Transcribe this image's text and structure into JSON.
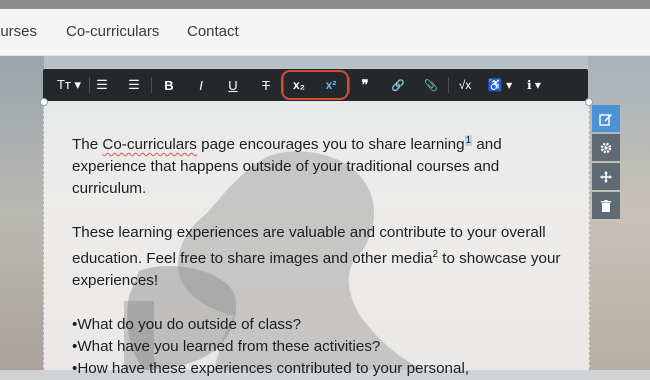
{
  "nav": {
    "items": [
      {
        "label": "ourses"
      },
      {
        "label": "Co-curriculars"
      },
      {
        "label": "Contact"
      }
    ]
  },
  "toolbar": {
    "buttons": [
      {
        "name": "text-style",
        "label": "Tт ▾"
      },
      {
        "name": "bullet-list",
        "label": "☰"
      },
      {
        "name": "numbered-list",
        "label": "☰"
      },
      {
        "name": "bold",
        "label": "B"
      },
      {
        "name": "italic",
        "label": "I"
      },
      {
        "name": "underline",
        "label": "U"
      },
      {
        "name": "strikethrough",
        "label": "T"
      },
      {
        "name": "subscript",
        "label": "x₂"
      },
      {
        "name": "superscript",
        "label": "x²"
      },
      {
        "name": "quote",
        "label": "❞"
      },
      {
        "name": "link",
        "label": "🔗"
      },
      {
        "name": "attach",
        "label": "📎"
      },
      {
        "name": "math",
        "label": "√x"
      },
      {
        "name": "accessibility",
        "label": "♿ ▾"
      },
      {
        "name": "info",
        "label": "ℹ ▾"
      }
    ]
  },
  "side_tools": [
    "edit-icon",
    "gear-icon",
    "move-icon",
    "trash-icon"
  ],
  "content": {
    "p1": {
      "a": "The ",
      "link": "Co-curriculars",
      "b": " page encourages you to share learning",
      "sup": "1",
      "c": " and experience that happens outside of your traditional courses and curriculum."
    },
    "p2": {
      "a": "These learning experiences are valuable and contribute to your overall education. Feel free to share images and other media",
      "sup": "2",
      "b": " to showcase your experiences!"
    },
    "bullets": [
      "•What do you do outside of class?",
      "•What have you learned from these activities?",
      "•How have these experiences contributed to your personal,"
    ]
  },
  "colors": {
    "toolbar": "#24282b",
    "highlight": "#d64a3a",
    "accent": "#4b92d6",
    "superscript_active": "#6fb0ff"
  }
}
